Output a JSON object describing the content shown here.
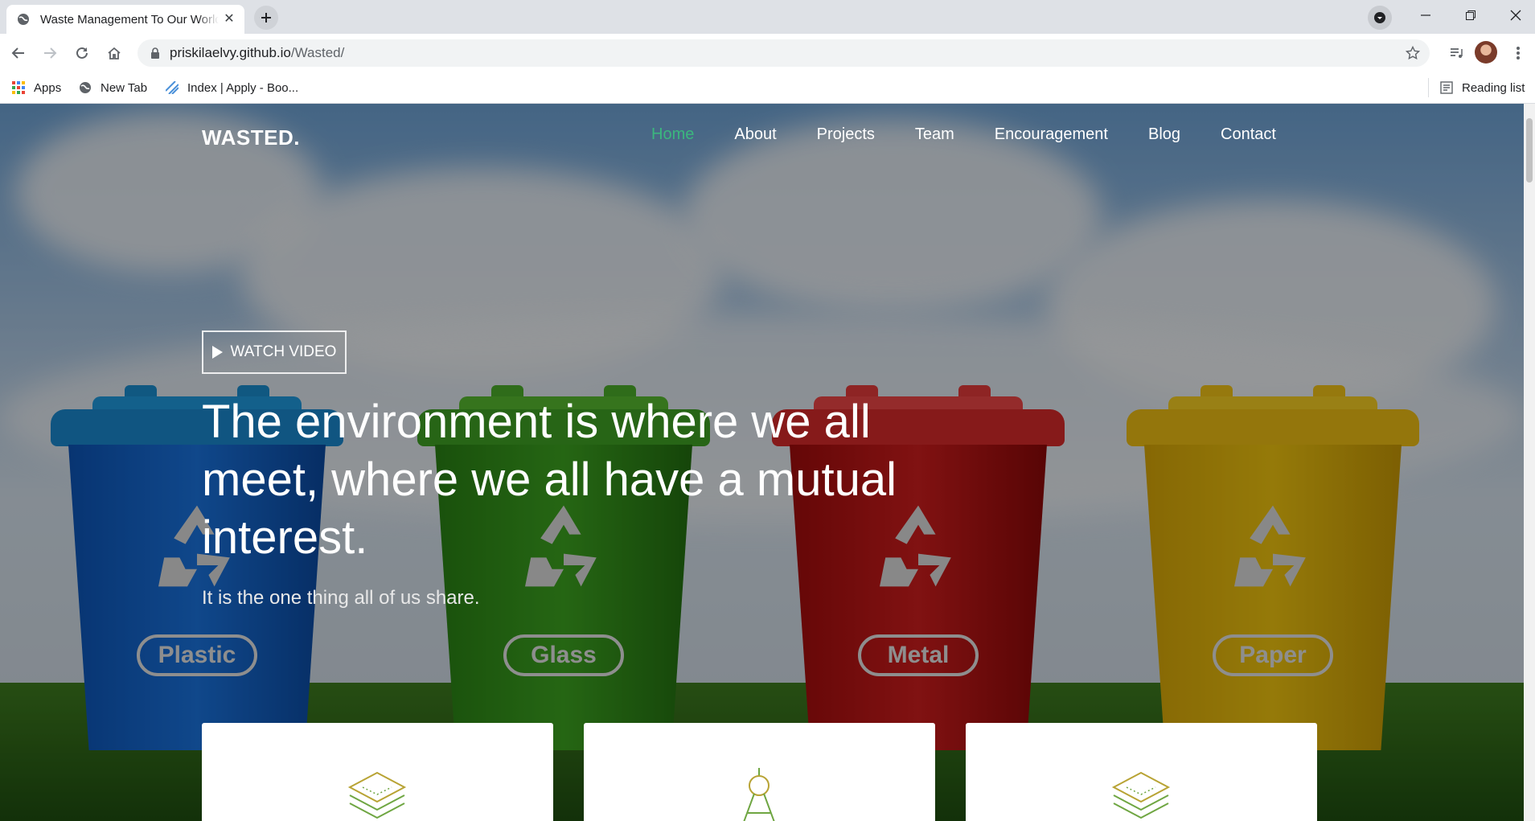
{
  "browser": {
    "tab_title": "Waste Management To Our World",
    "url_domain": "priskilaelvy.github.io",
    "url_path": "/Wasted/",
    "bookmarks": [
      "Apps",
      "New Tab",
      "Index | Apply - Boo..."
    ],
    "reading_list": "Reading list"
  },
  "site": {
    "logo": "WASTED.",
    "menu": [
      "Home",
      "About",
      "Projects",
      "Team",
      "Encouragement",
      "Blog",
      "Contact"
    ],
    "active_menu": "Home",
    "watch_video": "WATCH VIDEO",
    "headline": "The environment is where we all meet, where we all have a mutual interest.",
    "subline": "It is the one thing all of us share.",
    "bins": [
      "Plastic",
      "Glass",
      "Metal",
      "Paper"
    ],
    "accent_color": "#3bb77e"
  }
}
